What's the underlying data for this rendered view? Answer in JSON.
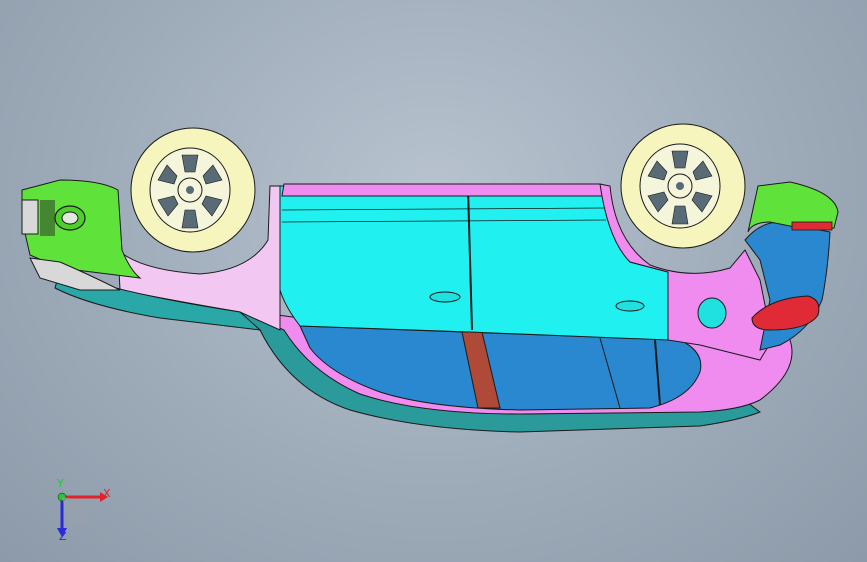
{
  "viewport": {
    "background_color": "#a3aebb"
  },
  "triad": {
    "x_label": "X",
    "y_label": "Y",
    "z_label": "Z",
    "x_color": "#e4202a",
    "y_color": "#25c33a",
    "z_color": "#2a2ad8"
  },
  "model": {
    "part_colors": {
      "front_bumper": "#5fe33a",
      "body_cyan": "#20f0f0",
      "body_pink": "#f08cf0",
      "body_light_pink": "#f2c8f2",
      "windows_blue": "#2a88d0",
      "tires": "#f5f5bd",
      "rear_light": "#e02a35",
      "pillar_brown": "#b04a38"
    }
  }
}
